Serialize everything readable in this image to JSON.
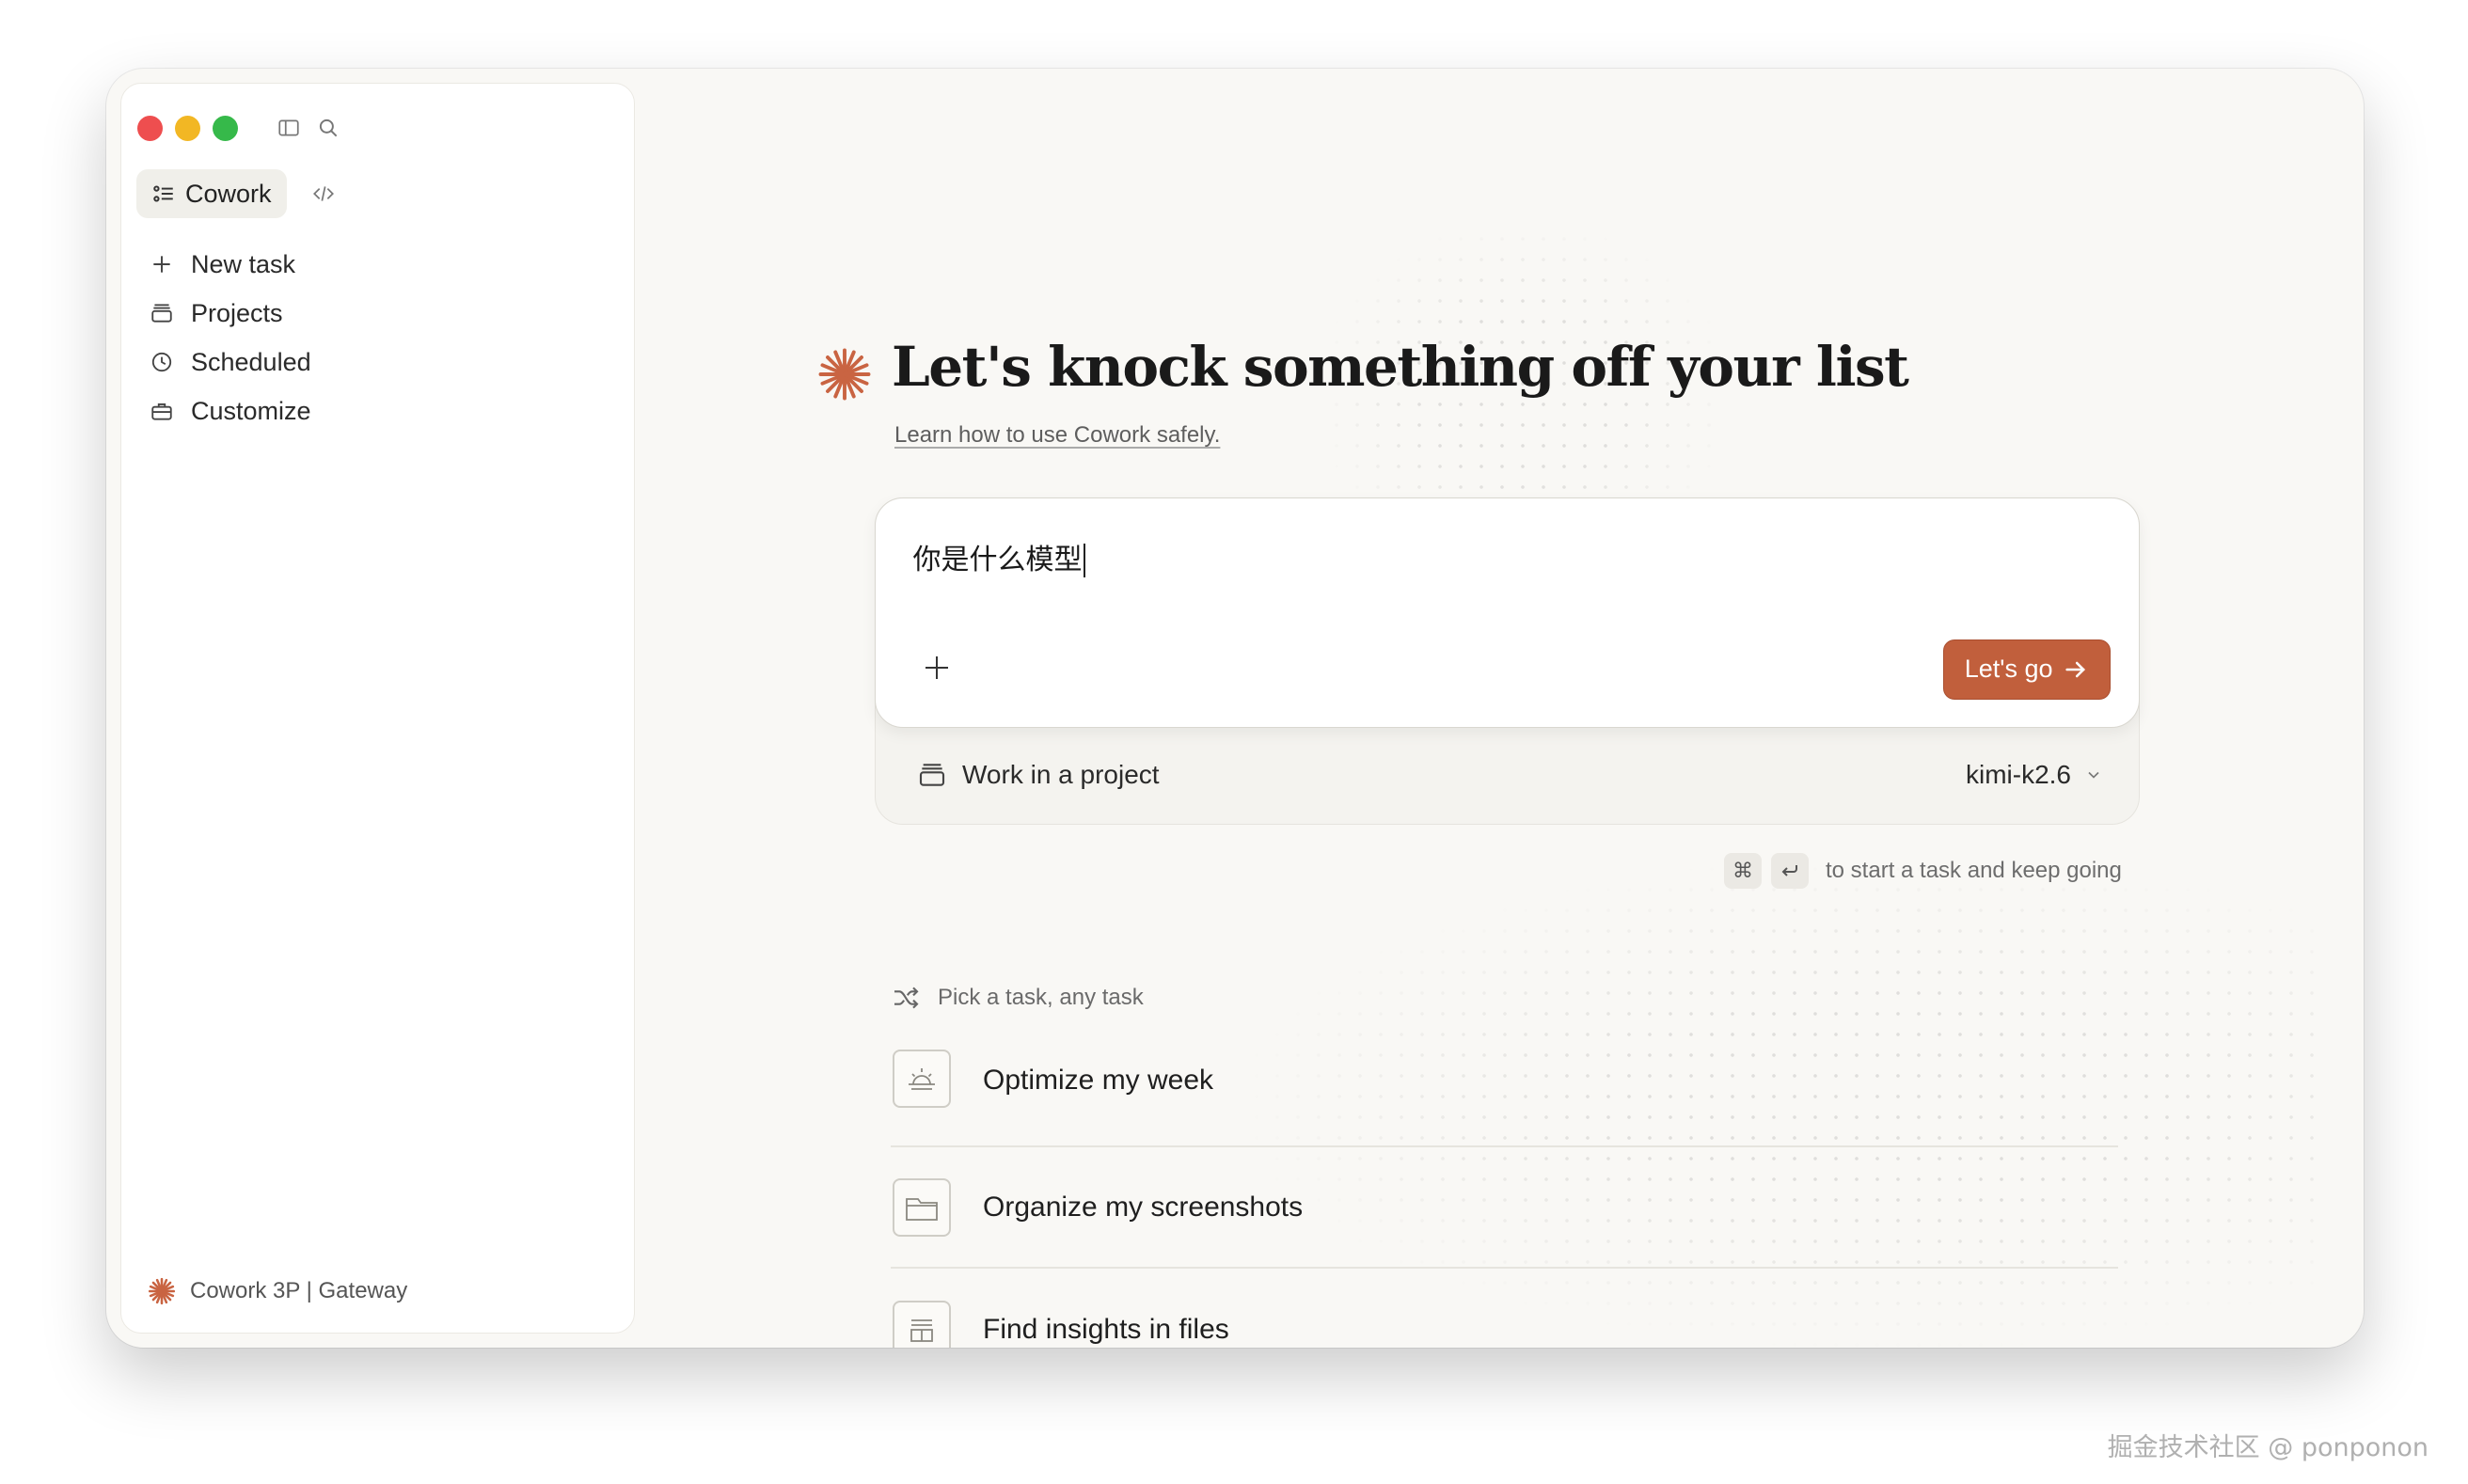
{
  "sidebar": {
    "mode_label": "Cowork",
    "nav": [
      {
        "label": "New task",
        "icon": "plus-icon"
      },
      {
        "label": "Projects",
        "icon": "folder-stack-icon"
      },
      {
        "label": "Scheduled",
        "icon": "clock-icon"
      },
      {
        "label": "Customize",
        "icon": "briefcase-icon"
      }
    ],
    "footer_label": "Cowork 3P | Gateway"
  },
  "main": {
    "title": "Let's knock something off your list",
    "safety_link": "Learn how to use Cowork safely.",
    "composer": {
      "value": "你是什么模型",
      "submit_label": "Let's go"
    },
    "project_label": "Work in a project",
    "model": "kimi-k2.6",
    "shortcut": {
      "key1": "⌘",
      "text": "to start a task and keep going"
    },
    "suggestions": {
      "header": "Pick a task, any task",
      "items": [
        {
          "label": "Optimize my week",
          "icon": "sunrise-calendar-icon"
        },
        {
          "label": "Organize my screenshots",
          "icon": "folder-icon"
        },
        {
          "label": "Find insights in files",
          "icon": "document-icon"
        }
      ]
    }
  },
  "colors": {
    "accent": "#c15f3c",
    "background": "#f9f8f5"
  },
  "watermark": "掘金技术社区 @ ponponon"
}
